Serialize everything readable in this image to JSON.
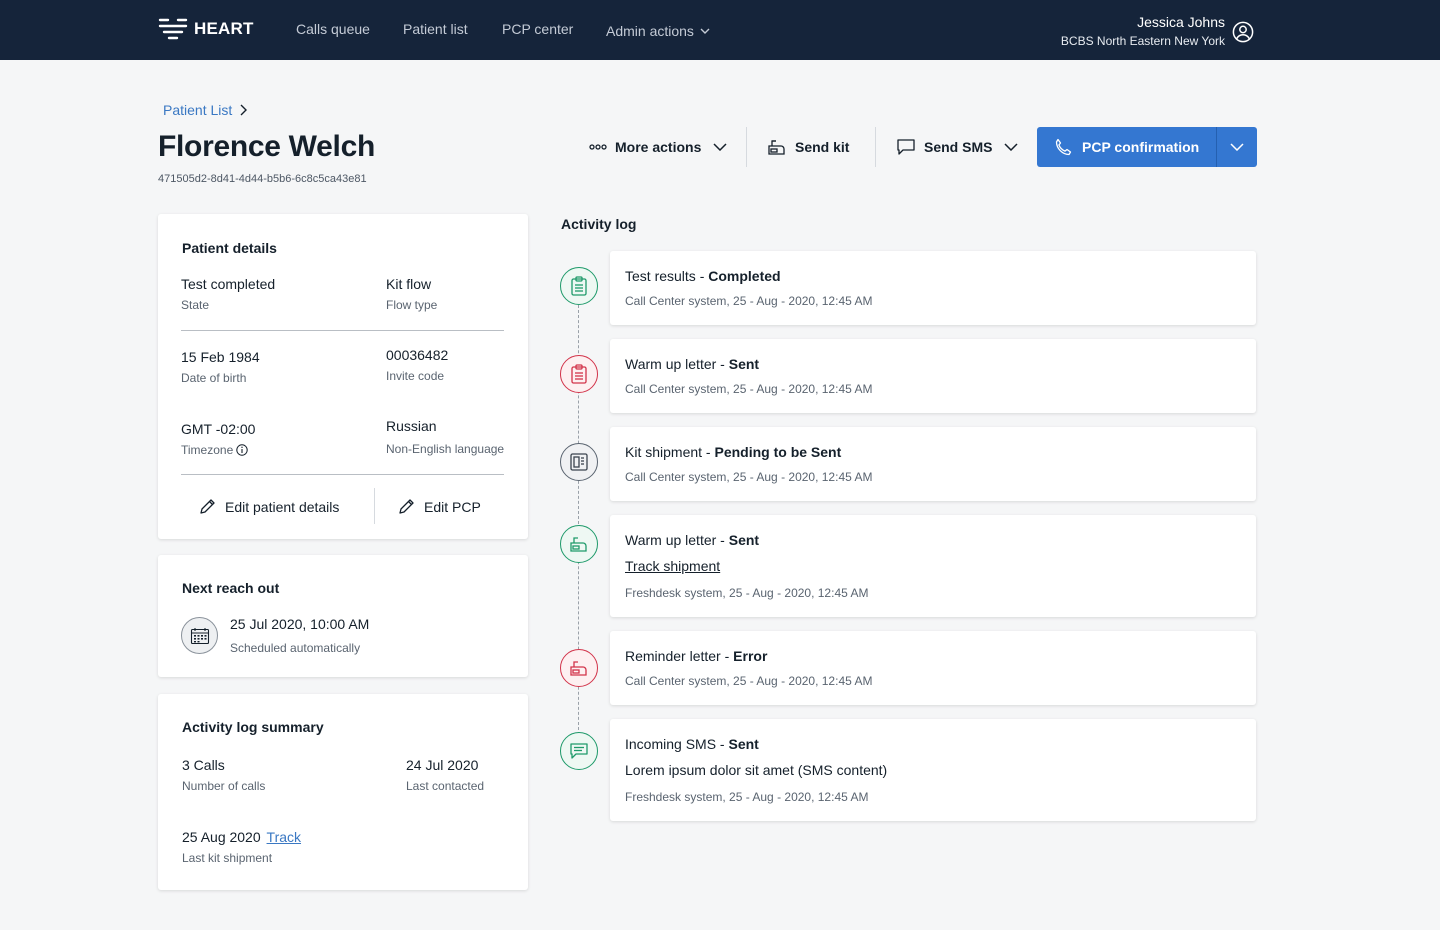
{
  "brand": {
    "name": "HEART"
  },
  "nav": [
    {
      "label": "Calls queue"
    },
    {
      "label": "Patient list"
    },
    {
      "label": "PCP center"
    },
    {
      "label": "Admin actions"
    }
  ],
  "user": {
    "name": "Jessica Johns",
    "org": "BCBS North Eastern New York"
  },
  "breadcrumb": {
    "label": "Patient List"
  },
  "patient": {
    "name": "Florence Welch",
    "id": "471505d2-8d41-4d44-b5b6-6c8c5ca43e81"
  },
  "actions": {
    "more_actions": "More actions",
    "send_kit": "Send kit",
    "send_sms": "Send SMS",
    "pcp_confirmation": "PCP confirmation"
  },
  "details": {
    "title": "Patient details",
    "state_value": "Test completed",
    "state_label": "State",
    "flow_value": "Kit flow",
    "flow_label": "Flow type",
    "dob_value": "15 Feb 1984",
    "dob_label": "Date of birth",
    "invite_value": "00036482",
    "invite_label": "Invite code",
    "tz_value": "GMT -02:00",
    "tz_label": "Timezone",
    "lang_value": "Russian",
    "lang_label": "Non-English language",
    "edit_details": "Edit patient details",
    "edit_pcp": "Edit PCP"
  },
  "reach_out": {
    "title": "Next reach out",
    "datetime": "25 Jul 2020, 10:00 AM",
    "note": "Scheduled automatically"
  },
  "summary": {
    "title": "Activity log summary",
    "calls_value": "3 Calls",
    "calls_label": "Number of calls",
    "last_contact_value": "24 Jul 2020",
    "last_contact_label": "Last contacted",
    "kit_value": "25 Aug 2020",
    "kit_link": "Track",
    "kit_label": "Last kit shipment"
  },
  "activity": {
    "title": "Activity log",
    "items": [
      {
        "event": "Test results - ",
        "status": "Completed",
        "meta": "Call Center system, 25 - Aug - 2020, 12:45 AM",
        "icon": "clipboard-icon",
        "color": "#1e9a6a"
      },
      {
        "event": "Warm up letter - ",
        "status": "Sent",
        "meta": "Call Center system, 25 - Aug - 2020, 12:45 AM",
        "icon": "clipboard-icon",
        "color": "#d2334a"
      },
      {
        "event": "Kit shipment - ",
        "status": "Pending to be Sent",
        "meta": "Call Center system, 25 - Aug - 2020, 12:45 AM",
        "icon": "kit-icon",
        "color": "#5a6470"
      },
      {
        "event": "Warm up letter - ",
        "status": "Sent",
        "link": "Track shipment",
        "meta": "Freshdesk system, 25 - Aug - 2020, 12:45 AM",
        "icon": "mailbox-icon",
        "color": "#1e9a6a"
      },
      {
        "event": "Reminder letter - ",
        "status": "Error",
        "meta": "Call Center system, 25 - Aug - 2020, 12:45 AM",
        "icon": "mailbox-icon",
        "color": "#d2334a"
      },
      {
        "event": "Incoming SMS - ",
        "status": "Sent",
        "body": "Lorem ipsum dolor sit amet (SMS content)",
        "meta": "Freshdesk system, 25 - Aug - 2020, 12:45 AM",
        "icon": "chat-icon",
        "color": "#1e9a6a"
      }
    ]
  }
}
